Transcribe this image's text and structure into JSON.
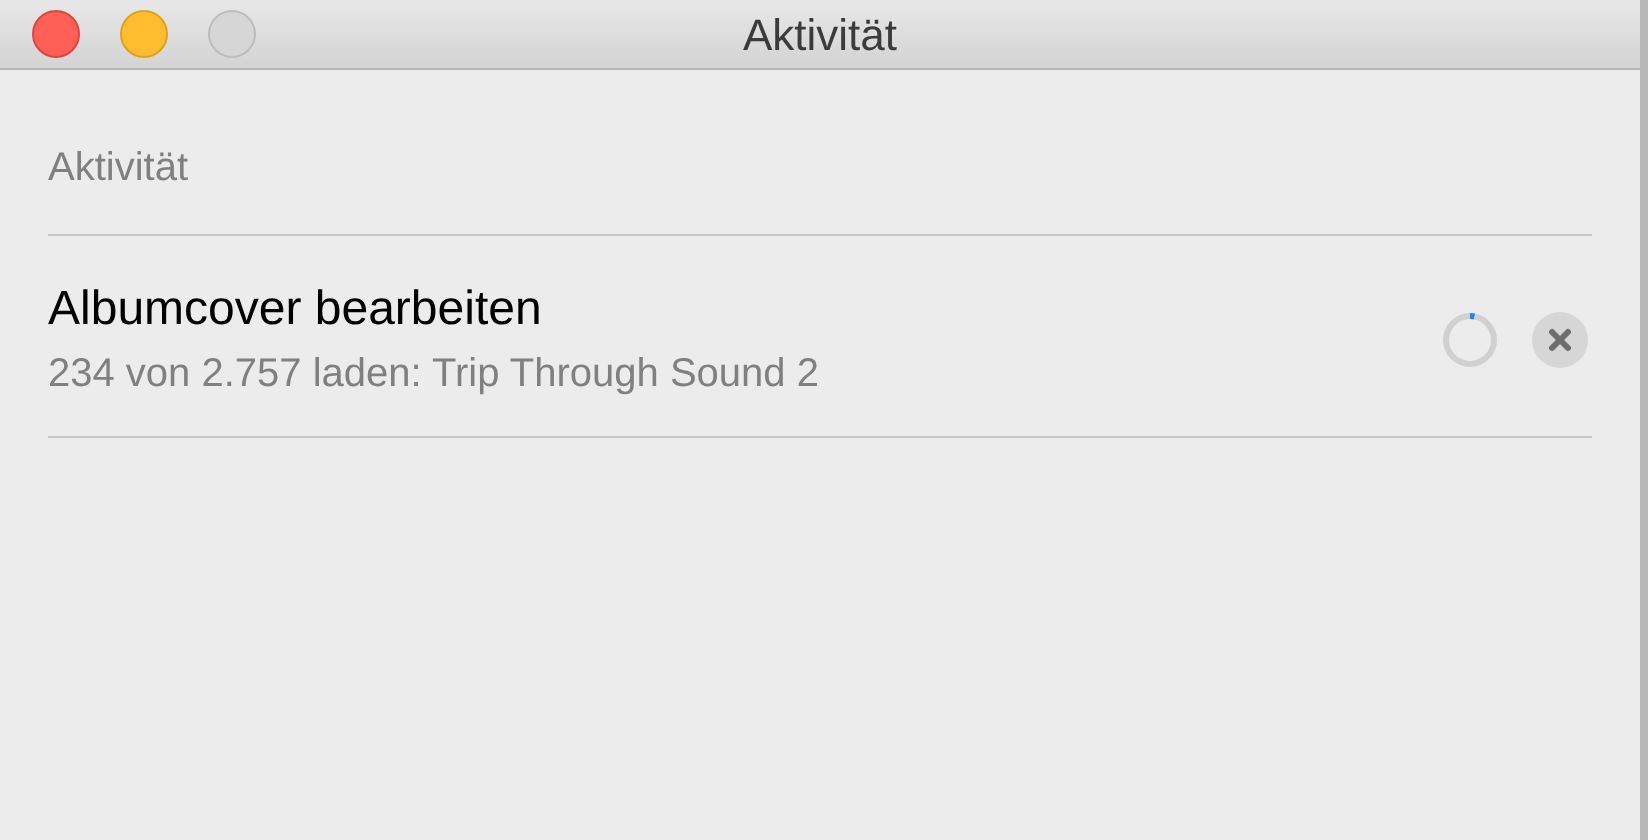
{
  "window": {
    "title": "Aktivität"
  },
  "section": {
    "title": "Aktivität"
  },
  "activities": [
    {
      "title": "Albumcover bearbeiten",
      "detail": "234 von 2.757 laden: Trip Through Sound 2"
    }
  ]
}
